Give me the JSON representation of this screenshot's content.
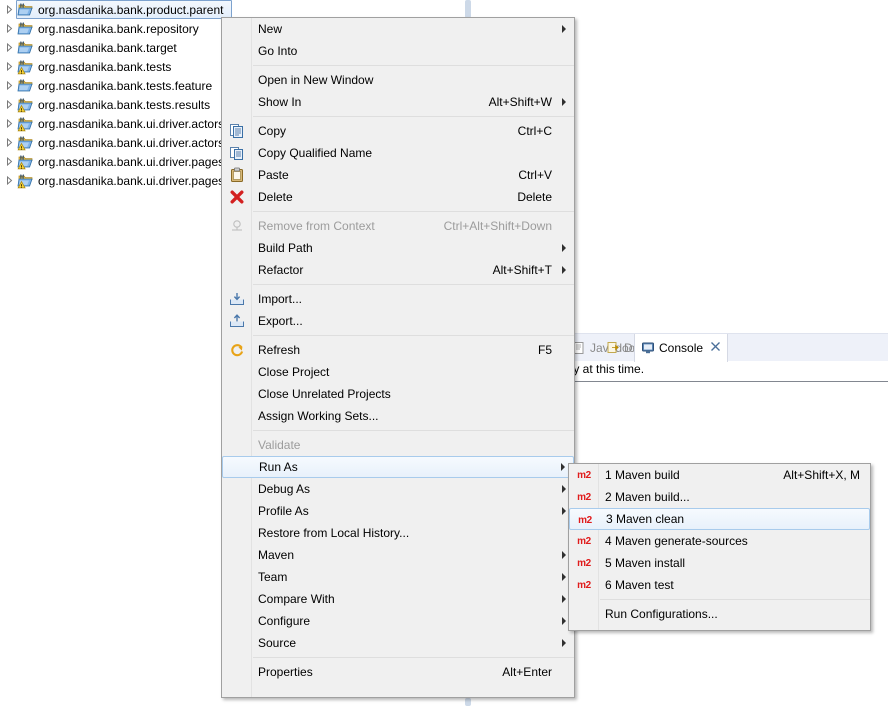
{
  "explorer": {
    "items": [
      {
        "label": "org.nasdanika.bank.product.parent",
        "icon": "maven-project-icon",
        "selected": true,
        "warning": false
      },
      {
        "label": "org.nasdanika.bank.repository",
        "icon": "maven-project-icon",
        "selected": false,
        "warning": false
      },
      {
        "label": "org.nasdanika.bank.target",
        "icon": "maven-project-icon",
        "selected": false,
        "warning": false
      },
      {
        "label": "org.nasdanika.bank.tests",
        "icon": "maven-project-icon",
        "selected": false,
        "warning": true
      },
      {
        "label": "org.nasdanika.bank.tests.feature",
        "icon": "maven-project-icon",
        "selected": false,
        "warning": false
      },
      {
        "label": "org.nasdanika.bank.tests.results",
        "icon": "maven-project-icon",
        "selected": false,
        "warning": true
      },
      {
        "label": "org.nasdanika.bank.ui.driver.actors",
        "icon": "maven-project-icon",
        "selected": false,
        "warning": true
      },
      {
        "label": "org.nasdanika.bank.ui.driver.actors",
        "icon": "maven-project-icon",
        "selected": false,
        "warning": true
      },
      {
        "label": "org.nasdanika.bank.ui.driver.pages",
        "icon": "maven-project-icon",
        "selected": false,
        "warning": true
      },
      {
        "label": "org.nasdanika.bank.ui.driver.pages",
        "icon": "maven-project-icon",
        "selected": false,
        "warning": true
      }
    ]
  },
  "console_panel": {
    "tabs": [
      {
        "label": "Javadoc",
        "icon": "javadoc-icon",
        "active": false,
        "closable": false
      },
      {
        "label": "Declaration",
        "icon": "declaration-icon",
        "active": false,
        "closable": false
      },
      {
        "label": "Console",
        "icon": "console-icon",
        "active": true,
        "closable": true
      }
    ],
    "body_text": "lay at this time."
  },
  "context_menu": {
    "items": [
      {
        "label": "New",
        "accel": "",
        "icon": "",
        "arrow": true,
        "disabled": false,
        "highlight": false
      },
      {
        "label": "Go Into",
        "accel": "",
        "icon": "",
        "arrow": false,
        "disabled": false,
        "highlight": false
      },
      {
        "separator": true
      },
      {
        "label": "Open in New Window",
        "accel": "",
        "icon": "",
        "arrow": false,
        "disabled": false,
        "highlight": false
      },
      {
        "label": "Show In",
        "accel": "Alt+Shift+W",
        "icon": "",
        "arrow": true,
        "disabled": false,
        "highlight": false
      },
      {
        "separator": true
      },
      {
        "label": "Copy",
        "accel": "Ctrl+C",
        "icon": "copy-icon",
        "arrow": false,
        "disabled": false,
        "highlight": false
      },
      {
        "label": "Copy Qualified Name",
        "accel": "",
        "icon": "copy-qualified-icon",
        "arrow": false,
        "disabled": false,
        "highlight": false
      },
      {
        "label": "Paste",
        "accel": "Ctrl+V",
        "icon": "paste-icon",
        "arrow": false,
        "disabled": false,
        "highlight": false
      },
      {
        "label": "Delete",
        "accel": "Delete",
        "icon": "delete-icon",
        "arrow": false,
        "disabled": false,
        "highlight": false
      },
      {
        "separator": true
      },
      {
        "label": "Remove from Context",
        "accel": "Ctrl+Alt+Shift+Down",
        "icon": "remove-context-icon",
        "arrow": false,
        "disabled": true,
        "highlight": false
      },
      {
        "label": "Build Path",
        "accel": "",
        "icon": "",
        "arrow": true,
        "disabled": false,
        "highlight": false
      },
      {
        "label": "Refactor",
        "accel": "Alt+Shift+T",
        "icon": "",
        "arrow": true,
        "disabled": false,
        "highlight": false
      },
      {
        "separator": true
      },
      {
        "label": "Import...",
        "accel": "",
        "icon": "import-icon",
        "arrow": false,
        "disabled": false,
        "highlight": false
      },
      {
        "label": "Export...",
        "accel": "",
        "icon": "export-icon",
        "arrow": false,
        "disabled": false,
        "highlight": false
      },
      {
        "separator": true
      },
      {
        "label": "Refresh",
        "accel": "F5",
        "icon": "refresh-icon",
        "arrow": false,
        "disabled": false,
        "highlight": false
      },
      {
        "label": "Close Project",
        "accel": "",
        "icon": "",
        "arrow": false,
        "disabled": false,
        "highlight": false
      },
      {
        "label": "Close Unrelated Projects",
        "accel": "",
        "icon": "",
        "arrow": false,
        "disabled": false,
        "highlight": false
      },
      {
        "label": "Assign Working Sets...",
        "accel": "",
        "icon": "",
        "arrow": false,
        "disabled": false,
        "highlight": false
      },
      {
        "separator": true
      },
      {
        "label": "Validate",
        "accel": "",
        "icon": "",
        "arrow": false,
        "disabled": true,
        "highlight": false
      },
      {
        "label": "Run As",
        "accel": "",
        "icon": "",
        "arrow": true,
        "disabled": false,
        "highlight": true
      },
      {
        "label": "Debug As",
        "accel": "",
        "icon": "",
        "arrow": true,
        "disabled": false,
        "highlight": false
      },
      {
        "label": "Profile As",
        "accel": "",
        "icon": "",
        "arrow": true,
        "disabled": false,
        "highlight": false
      },
      {
        "label": "Restore from Local History...",
        "accel": "",
        "icon": "",
        "arrow": false,
        "disabled": false,
        "highlight": false
      },
      {
        "label": "Maven",
        "accel": "",
        "icon": "",
        "arrow": true,
        "disabled": false,
        "highlight": false
      },
      {
        "label": "Team",
        "accel": "",
        "icon": "",
        "arrow": true,
        "disabled": false,
        "highlight": false
      },
      {
        "label": "Compare With",
        "accel": "",
        "icon": "",
        "arrow": true,
        "disabled": false,
        "highlight": false
      },
      {
        "label": "Configure",
        "accel": "",
        "icon": "",
        "arrow": true,
        "disabled": false,
        "highlight": false
      },
      {
        "label": "Source",
        "accel": "",
        "icon": "",
        "arrow": true,
        "disabled": false,
        "highlight": false
      },
      {
        "separator": true
      },
      {
        "label": "Properties",
        "accel": "Alt+Enter",
        "icon": "",
        "arrow": false,
        "disabled": false,
        "highlight": false
      }
    ]
  },
  "run_as_submenu": {
    "items": [
      {
        "label": "1 Maven build",
        "accel": "Alt+Shift+X, M",
        "icon": "m2-icon",
        "highlight": false
      },
      {
        "label": "2 Maven build...",
        "accel": "",
        "icon": "m2-icon",
        "highlight": false
      },
      {
        "label": "3 Maven clean",
        "accel": "",
        "icon": "m2-icon",
        "highlight": true
      },
      {
        "label": "4 Maven generate-sources",
        "accel": "",
        "icon": "m2-icon",
        "highlight": false
      },
      {
        "label": "5 Maven install",
        "accel": "",
        "icon": "m2-icon",
        "highlight": false
      },
      {
        "label": "6 Maven test",
        "accel": "",
        "icon": "m2-icon",
        "highlight": false
      },
      {
        "separator": true
      },
      {
        "label": "Run Configurations...",
        "accel": "",
        "icon": "",
        "highlight": false
      }
    ]
  },
  "colors": {
    "menu_bg": "#f0f0f0",
    "menu_border": "#a0a0a0",
    "highlight_border": "#a8cbec",
    "selection_border": "#7da2ce",
    "m2_red": "#e01b1b",
    "disabled_text": "#9c9c9c",
    "tab_strip": "#eef1f9"
  }
}
